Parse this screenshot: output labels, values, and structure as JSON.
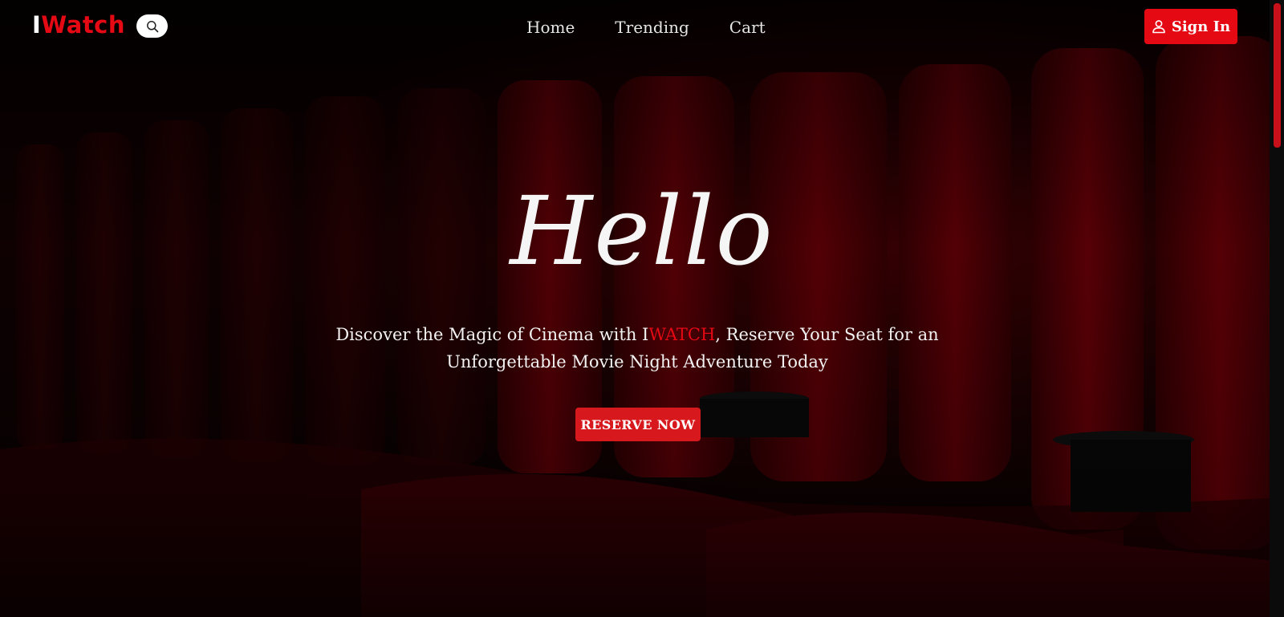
{
  "header": {
    "logo_prefix": "I",
    "logo_suffix": "Watch",
    "search_icon": "search-icon",
    "nav": [
      {
        "label": "Home"
      },
      {
        "label": "Trending"
      },
      {
        "label": "Cart"
      }
    ],
    "signin_label": "Sign In",
    "signin_icon": "user-icon"
  },
  "hero": {
    "title": "Hello",
    "subtitle_before": "Discover the Magic of Cinema with I",
    "subtitle_brand": "WATCH",
    "subtitle_after": ", Reserve Your Seat for an Unforgettable Movie Night Adventure Today",
    "cta_label": "RESERVE NOW"
  },
  "colors": {
    "accent": "#e50914",
    "cta": "#d7191e",
    "text": "#f2f2f2"
  }
}
